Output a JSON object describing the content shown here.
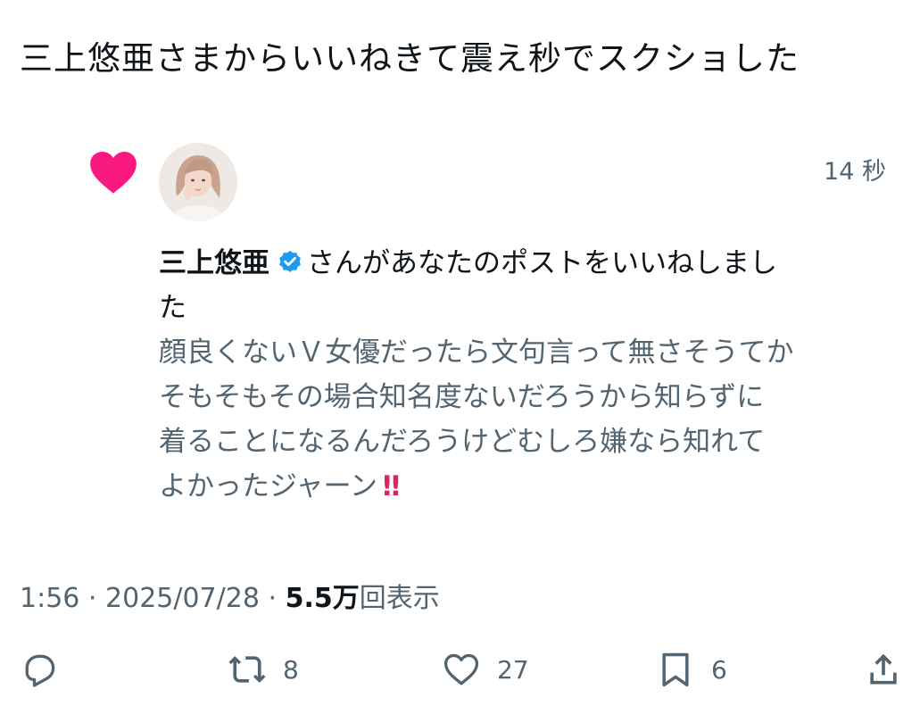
{
  "post": {
    "text": "三上悠亜さまからいいねきて震え秒でスクショした"
  },
  "notification": {
    "time_ago": "14 秒",
    "name": "三上悠亜",
    "action_text_line1": "さんがあなたのポストをいいねしまし",
    "action_text_line2": "た",
    "quoted_lines": [
      "顔良くないＶ女優だったら文句言って無さそうてか",
      "そもそもその場合知名度ないだろうから知らずに",
      "着ることになるんだろうけどむしろ嫌なら知れて",
      "よかったジャーン"
    ],
    "quoted_emoji": "‼"
  },
  "meta": {
    "time": "1:56",
    "sep1": "·",
    "date": "2025/07/28",
    "sep2": "·",
    "views_count": "5.5万",
    "views_label": "回表示"
  },
  "actions": {
    "reply_count": "",
    "repost_count": "8",
    "like_count": "27",
    "bookmark_count": "6"
  },
  "colors": {
    "heart": "#f91880",
    "verified": "#1d9bf0",
    "secondary_text": "#536471",
    "primary_text": "#0f1419"
  },
  "icons": {
    "heart": "heart-icon",
    "avatar": "avatar",
    "verified": "verified-badge-icon",
    "reply": "reply-icon",
    "repost": "repost-icon",
    "like": "like-icon",
    "bookmark": "bookmark-icon",
    "share": "share-icon"
  }
}
